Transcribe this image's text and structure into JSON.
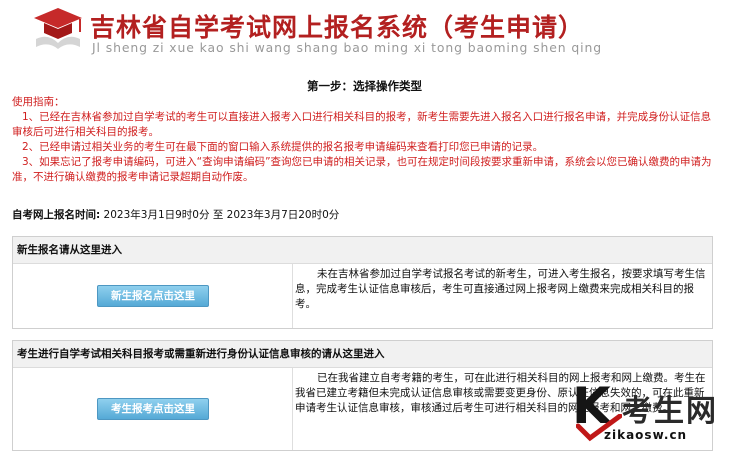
{
  "header": {
    "system_title": "吉林省自学考试网上报名系统（考生申请）",
    "pinyin": "Jl sheng zi xue kao shi wang shang bao ming xi tong baoming shen qing"
  },
  "step_title": "第一步：选择操作类型",
  "guide": {
    "label": "使用指南：",
    "items": [
      "1、已经在吉林省参加过自学考试的考生可以直接进入报考入口进行相关科目的报考，新考生需要先进入报名入口进行报名申请，并完成身份认证信息审核后可进行相关科目的报考。",
      "2、已经申请过相关业务的考生可在最下面的窗口输入系统提供的报名报考申请编码来查看打印您已申请的记录。",
      "3、如果忘记了报考申请编码，可进入“查询申请编码”查询您已申请的相关记录，也可在规定时间段按要求重新申请，系统会以您已确认缴费的申请为准，不进行确认缴费的报考申请记录超期自动作废。"
    ]
  },
  "exam_time": {
    "label": "自考网上报名时间:",
    "value": "2023年3月1日9时0分 至 2023年3月7日20时0分"
  },
  "panels": [
    {
      "heading": "新生报名请从这里进入",
      "button": "新生报名点击这里",
      "description": "未在吉林省参加过自学考试报名考试的新考生，可进入考生报名，按要求填写考生信息，完成考生认证信息审核后，考生可直接通过网上报考网上缴费来完成相关科目的报考。"
    },
    {
      "heading": "考生进行自学考试相关科目报考或需重新进行身份认证信息审核的请从这里进入",
      "button": "考生报考点击这里",
      "description": "已在我省建立自考考籍的考生，可在此进行相关科目的网上报考和网上缴费。考生在我省已建立考籍但未完成认证信息审核或需要变更身份、原认证信息失效的，可在此重新申请考生认证信息审核，审核通过后考生可进行相关科目的网上报考和网上缴费。"
    }
  ],
  "watermark": {
    "brand": "考生网",
    "url": "zikaosw.cn"
  },
  "colors": {
    "title_red": "#b32020",
    "guide_red": "#d02020",
    "button_blue": "#55a9d6",
    "panel_header_bg": "#f1f1f1"
  },
  "icons": {
    "logo": "graduation-cap-book-icon",
    "watermark_check": "checkmark-swoosh-icon"
  }
}
